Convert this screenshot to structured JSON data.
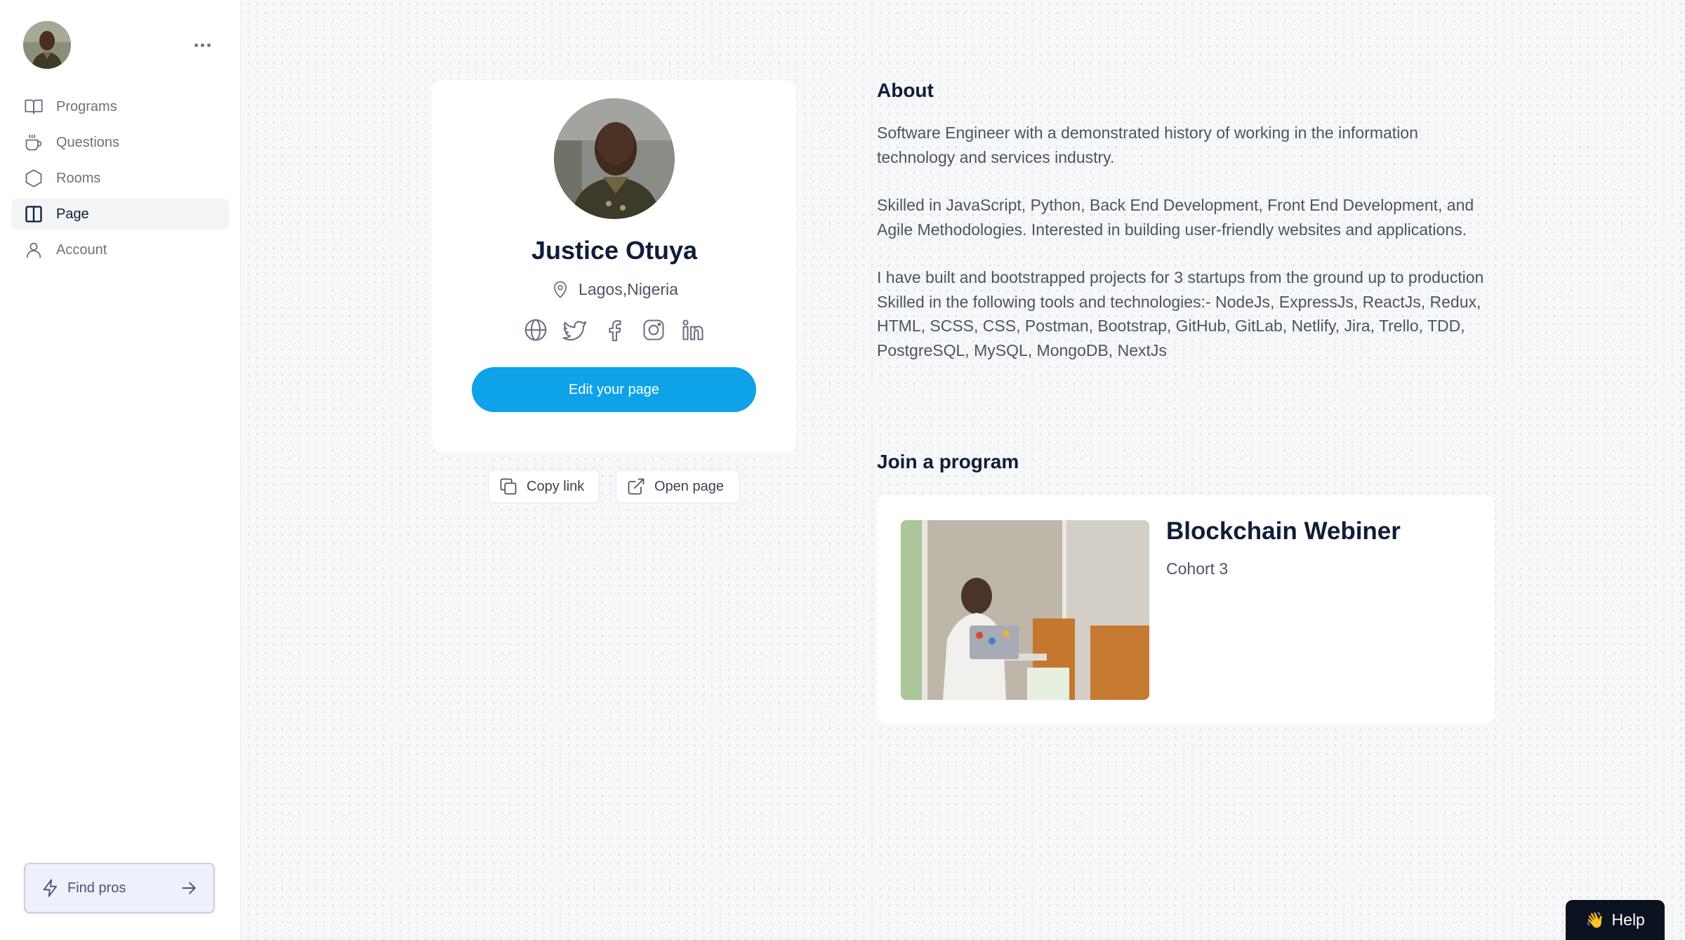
{
  "sidebar": {
    "items": [
      {
        "label": "Programs",
        "icon": "book-open-icon",
        "active": false
      },
      {
        "label": "Questions",
        "icon": "coffee-cup-icon",
        "active": false
      },
      {
        "label": "Rooms",
        "icon": "hexagon-icon",
        "active": false
      },
      {
        "label": "Page",
        "icon": "columns-icon",
        "active": true
      },
      {
        "label": "Account",
        "icon": "user-icon",
        "active": false
      }
    ],
    "find_pros_label": "Find pros"
  },
  "profile": {
    "name": "Justice Otuya",
    "location": "Lagos,Nigeria",
    "socials": [
      "globe-icon",
      "twitter-icon",
      "facebook-icon",
      "instagram-icon",
      "linkedin-icon"
    ],
    "edit_label": "Edit your page",
    "copy_link_label": "Copy link",
    "open_page_label": "Open page"
  },
  "about": {
    "title": "About",
    "paragraphs": [
      "Software Engineer with a demonstrated history of working in the information technology and services industry.",
      "Skilled in JavaScript, Python, Back End Development, Front End Development, and Agile Methodologies. Interested in building user-friendly websites and applications.",
      "I have built and bootstrapped projects for 3 startups from the ground up to production Skilled in the following tools and technologies:- NodeJs, ExpressJs, ReactJs, Redux, HTML, SCSS, CSS, Postman, Bootstrap, GitHub, GitLab, Netlify, Jira, Trello, TDD, PostgreSQL, MySQL, MongoDB, NextJs"
    ]
  },
  "programs": {
    "title": "Join a program",
    "items": [
      {
        "title": "Blockchain Webiner",
        "subtitle": "Cohort 3"
      }
    ]
  },
  "help": {
    "label": "Help",
    "emoji": "👋"
  },
  "colors": {
    "accent": "#0ea2e8",
    "text_dark": "#0f1d3a",
    "text_muted": "#4b5563",
    "help_bg": "#0b1220"
  }
}
